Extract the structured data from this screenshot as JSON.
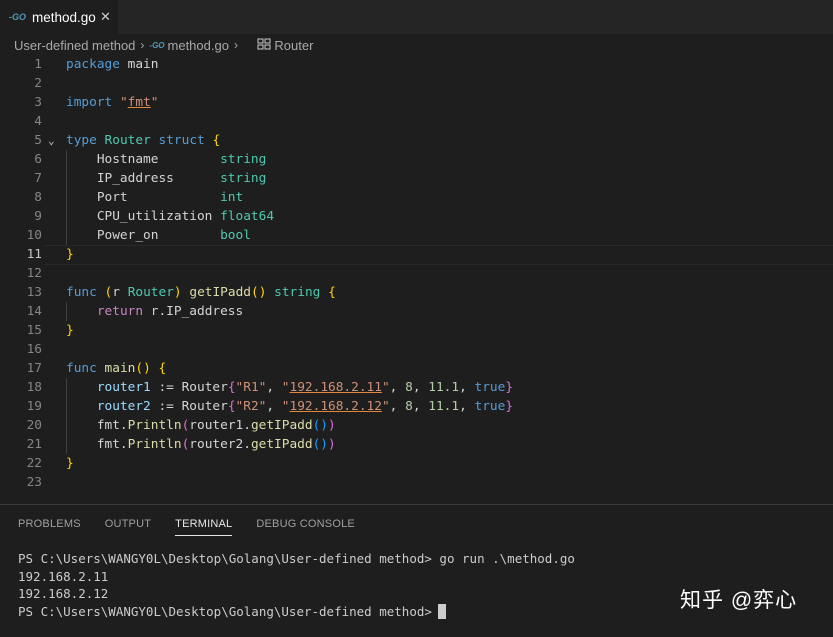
{
  "tab": {
    "icon": "go-icon",
    "label": "method.go"
  },
  "breadcrumb": {
    "folder": "User-defined method",
    "file": "method.go",
    "symbol": "Router"
  },
  "editor": {
    "active_line": 11,
    "lines": [
      {
        "num": "1"
      },
      {
        "num": "2"
      },
      {
        "num": "3"
      },
      {
        "num": "4"
      },
      {
        "num": "5"
      },
      {
        "num": "6"
      },
      {
        "num": "7"
      },
      {
        "num": "8"
      },
      {
        "num": "9"
      },
      {
        "num": "10"
      },
      {
        "num": "11"
      },
      {
        "num": "12"
      },
      {
        "num": "13"
      },
      {
        "num": "14"
      },
      {
        "num": "15"
      },
      {
        "num": "16"
      },
      {
        "num": "17"
      },
      {
        "num": "18"
      },
      {
        "num": "19"
      },
      {
        "num": "20"
      },
      {
        "num": "21"
      },
      {
        "num": "22"
      },
      {
        "num": "23"
      }
    ],
    "code": [
      [
        {
          "t": "package",
          "c": "k"
        },
        {
          "t": " main",
          "c": "p"
        }
      ],
      [],
      [
        {
          "t": "import",
          "c": "k"
        },
        {
          "t": " ",
          "c": "p"
        },
        {
          "t": "\"",
          "c": "s"
        },
        {
          "t": "fmt",
          "c": "s u"
        },
        {
          "t": "\"",
          "c": "s"
        }
      ],
      [],
      [
        {
          "t": "type",
          "c": "k"
        },
        {
          "t": " ",
          "c": "p"
        },
        {
          "t": "Router",
          "c": "t"
        },
        {
          "t": " ",
          "c": "p"
        },
        {
          "t": "struct",
          "c": "k"
        },
        {
          "t": " ",
          "c": "p"
        },
        {
          "t": "{",
          "c": "b1"
        }
      ],
      [
        {
          "t": "    Hostname        ",
          "c": "p"
        },
        {
          "t": "string",
          "c": "t"
        }
      ],
      [
        {
          "t": "    IP_address      ",
          "c": "p"
        },
        {
          "t": "string",
          "c": "t"
        }
      ],
      [
        {
          "t": "    Port            ",
          "c": "p"
        },
        {
          "t": "int",
          "c": "t"
        }
      ],
      [
        {
          "t": "    CPU_utilization ",
          "c": "p"
        },
        {
          "t": "float64",
          "c": "t"
        }
      ],
      [
        {
          "t": "    Power_on        ",
          "c": "p"
        },
        {
          "t": "bool",
          "c": "t"
        }
      ],
      [
        {
          "t": "}",
          "c": "b1"
        }
      ],
      [],
      [
        {
          "t": "func",
          "c": "k"
        },
        {
          "t": " ",
          "c": "p"
        },
        {
          "t": "(",
          "c": "b1"
        },
        {
          "t": "r ",
          "c": "p"
        },
        {
          "t": "Router",
          "c": "t"
        },
        {
          "t": ")",
          "c": "b1"
        },
        {
          "t": " ",
          "c": "p"
        },
        {
          "t": "getIPadd",
          "c": "f"
        },
        {
          "t": "()",
          "c": "b1"
        },
        {
          "t": " ",
          "c": "p"
        },
        {
          "t": "string",
          "c": "t"
        },
        {
          "t": " ",
          "c": "p"
        },
        {
          "t": "{",
          "c": "b1"
        }
      ],
      [
        {
          "t": "    ",
          "c": "p"
        },
        {
          "t": "return",
          "c": "c"
        },
        {
          "t": " r.IP_address",
          "c": "p"
        }
      ],
      [
        {
          "t": "}",
          "c": "b1"
        }
      ],
      [],
      [
        {
          "t": "func",
          "c": "k"
        },
        {
          "t": " ",
          "c": "p"
        },
        {
          "t": "main",
          "c": "f"
        },
        {
          "t": "()",
          "c": "b1"
        },
        {
          "t": " ",
          "c": "p"
        },
        {
          "t": "{",
          "c": "b1"
        }
      ],
      [
        {
          "t": "    ",
          "c": "p"
        },
        {
          "t": "router1",
          "c": "v"
        },
        {
          "t": " := Router",
          "c": "p"
        },
        {
          "t": "{",
          "c": "b2"
        },
        {
          "t": "\"R1\"",
          "c": "s"
        },
        {
          "t": ", ",
          "c": "p"
        },
        {
          "t": "\"",
          "c": "s"
        },
        {
          "t": "192.168.2.11",
          "c": "s u"
        },
        {
          "t": "\"",
          "c": "s"
        },
        {
          "t": ", ",
          "c": "p"
        },
        {
          "t": "8",
          "c": "n"
        },
        {
          "t": ", ",
          "c": "p"
        },
        {
          "t": "11.1",
          "c": "n"
        },
        {
          "t": ", ",
          "c": "p"
        },
        {
          "t": "true",
          "c": "k"
        },
        {
          "t": "}",
          "c": "b2"
        }
      ],
      [
        {
          "t": "    ",
          "c": "p"
        },
        {
          "t": "router2",
          "c": "v"
        },
        {
          "t": " := Router",
          "c": "p"
        },
        {
          "t": "{",
          "c": "b2"
        },
        {
          "t": "\"R2\"",
          "c": "s"
        },
        {
          "t": ", ",
          "c": "p"
        },
        {
          "t": "\"",
          "c": "s"
        },
        {
          "t": "192.168.2.12",
          "c": "s u"
        },
        {
          "t": "\"",
          "c": "s"
        },
        {
          "t": ", ",
          "c": "p"
        },
        {
          "t": "8",
          "c": "n"
        },
        {
          "t": ", ",
          "c": "p"
        },
        {
          "t": "11.1",
          "c": "n"
        },
        {
          "t": ", ",
          "c": "p"
        },
        {
          "t": "true",
          "c": "k"
        },
        {
          "t": "}",
          "c": "b2"
        }
      ],
      [
        {
          "t": "    fmt.",
          "c": "p"
        },
        {
          "t": "Println",
          "c": "f"
        },
        {
          "t": "(",
          "c": "b2"
        },
        {
          "t": "router1.",
          "c": "p"
        },
        {
          "t": "getIPadd",
          "c": "f"
        },
        {
          "t": "()",
          "c": "b3"
        },
        {
          "t": ")",
          "c": "b2"
        }
      ],
      [
        {
          "t": "    fmt.",
          "c": "p"
        },
        {
          "t": "Println",
          "c": "f"
        },
        {
          "t": "(",
          "c": "b2"
        },
        {
          "t": "router2.",
          "c": "p"
        },
        {
          "t": "getIPadd",
          "c": "f"
        },
        {
          "t": "()",
          "c": "b3"
        },
        {
          "t": ")",
          "c": "b2"
        }
      ],
      [
        {
          "t": "}",
          "c": "b1"
        }
      ],
      []
    ]
  },
  "panel": {
    "tabs": [
      "PROBLEMS",
      "OUTPUT",
      "TERMINAL",
      "DEBUG CONSOLE"
    ],
    "active_tab": "TERMINAL",
    "terminal": [
      "PS C:\\Users\\WANGY0L\\Desktop\\Golang\\User-defined method> go run .\\method.go",
      "192.168.2.11",
      "192.168.2.12",
      "PS C:\\Users\\WANGY0L\\Desktop\\Golang\\User-defined method>"
    ]
  },
  "watermark": "知乎 @弈心"
}
